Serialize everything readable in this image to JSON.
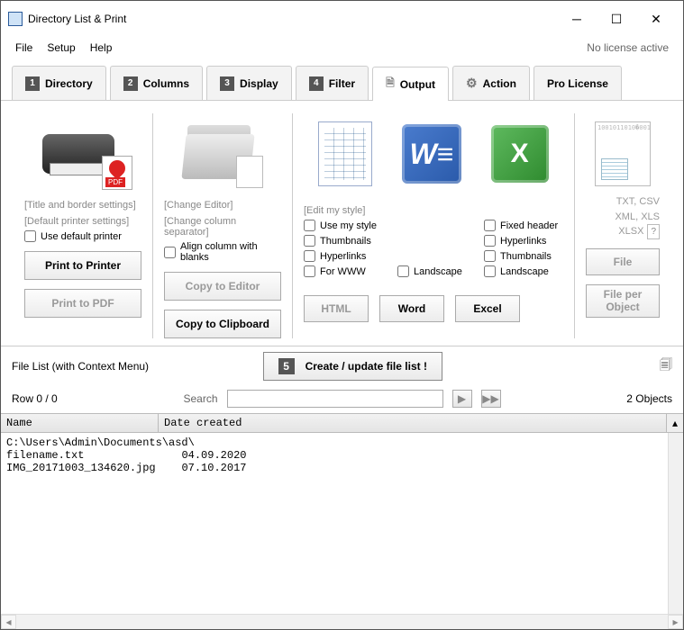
{
  "window": {
    "title": "Directory List & Print"
  },
  "menu": {
    "file": "File",
    "setup": "Setup",
    "help": "Help",
    "license": "No license active"
  },
  "tabs": {
    "directory": {
      "num": "1",
      "label": "Directory"
    },
    "columns": {
      "num": "2",
      "label": "Columns"
    },
    "display": {
      "num": "3",
      "label": "Display"
    },
    "filter": {
      "num": "4",
      "label": "Filter"
    },
    "output": {
      "label": "Output"
    },
    "action": {
      "label": "Action"
    },
    "pro": {
      "label": "Pro License"
    }
  },
  "print": {
    "title_settings": "[Title and border settings]",
    "default_settings": "[Default printer settings]",
    "use_default": "Use default printer",
    "to_printer": "Print to Printer",
    "to_pdf": "Print to PDF"
  },
  "clip": {
    "change_editor": "[Change Editor]",
    "change_sep": "[Change column separator]",
    "align": "Align column with blanks",
    "to_editor": "Copy to Editor",
    "to_clipboard": "Copy to Clipboard"
  },
  "export": {
    "edit_style": "[Edit my style]",
    "use_style": "Use my style",
    "thumbnails": "Thumbnails",
    "hyperlinks": "Hyperlinks",
    "for_www": "For WWW",
    "landscape": "Landscape",
    "fixed_header": "Fixed header",
    "html": "HTML",
    "word": "Word",
    "excel": "Excel"
  },
  "fileout": {
    "txt_csv": "TXT, CSV",
    "xml_xls": "XML, XLS",
    "xlsx": "XLSX",
    "file": "File",
    "file_per_object": "File per Object"
  },
  "mid": {
    "filelist_label": "File List (with Context Menu)",
    "create_num": "5",
    "create_label": "Create / update file list !"
  },
  "status": {
    "row": "Row 0 / 0",
    "search": "Search",
    "objects": "2 Objects"
  },
  "columns": {
    "name": "Name",
    "date": "Date created"
  },
  "files": {
    "path": "C:\\Users\\Admin\\Documents\\asd\\",
    "rows": [
      {
        "name": "filename.txt",
        "date": "04.09.2020"
      },
      {
        "name": "IMG_20171003_134620.jpg",
        "date": "07.10.2017"
      }
    ]
  }
}
